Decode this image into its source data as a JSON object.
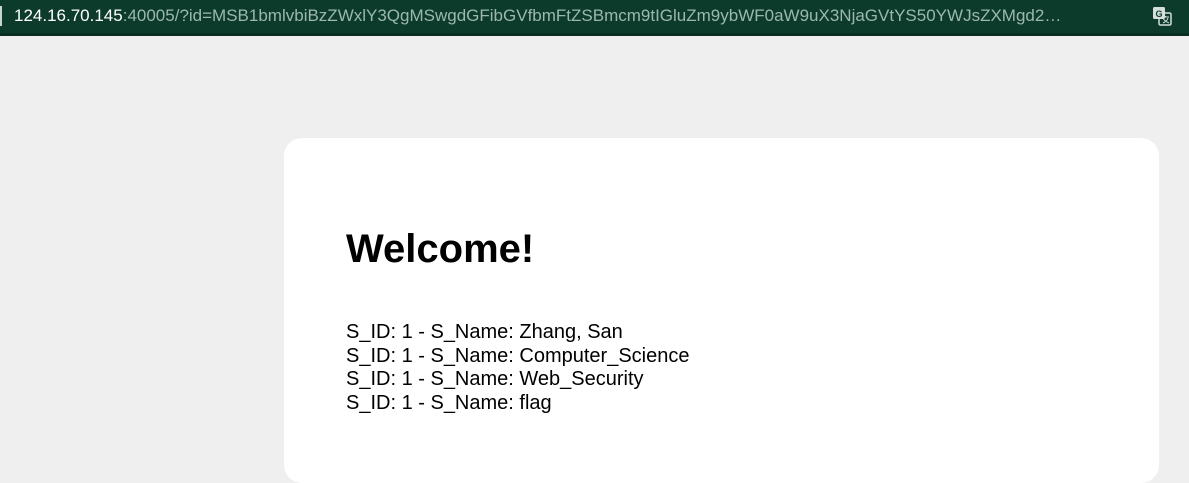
{
  "address_bar": {
    "host": "124.16.70.145",
    "rest": ":40005/?id=MSB1bmlvbiBzZWxlY3QgMSwgdGFibGVfbmFtZSBmcm9tIGluZm9ybWF0aW9uX3NjaGVtYS50YWJsZXMgd2…",
    "icon": "translate-icon"
  },
  "page": {
    "title": "Welcome!",
    "rows": [
      "S_ID: 1 - S_Name: Zhang, San",
      "S_ID: 1 - S_Name: Computer_Science",
      "S_ID: 1 - S_Name: Web_Security",
      "S_ID: 1 - S_Name: flag"
    ]
  },
  "colors": {
    "address_bar_bg": "#0d3b2b",
    "page_bg": "#efeff0",
    "card_bg": "#ffffff"
  }
}
